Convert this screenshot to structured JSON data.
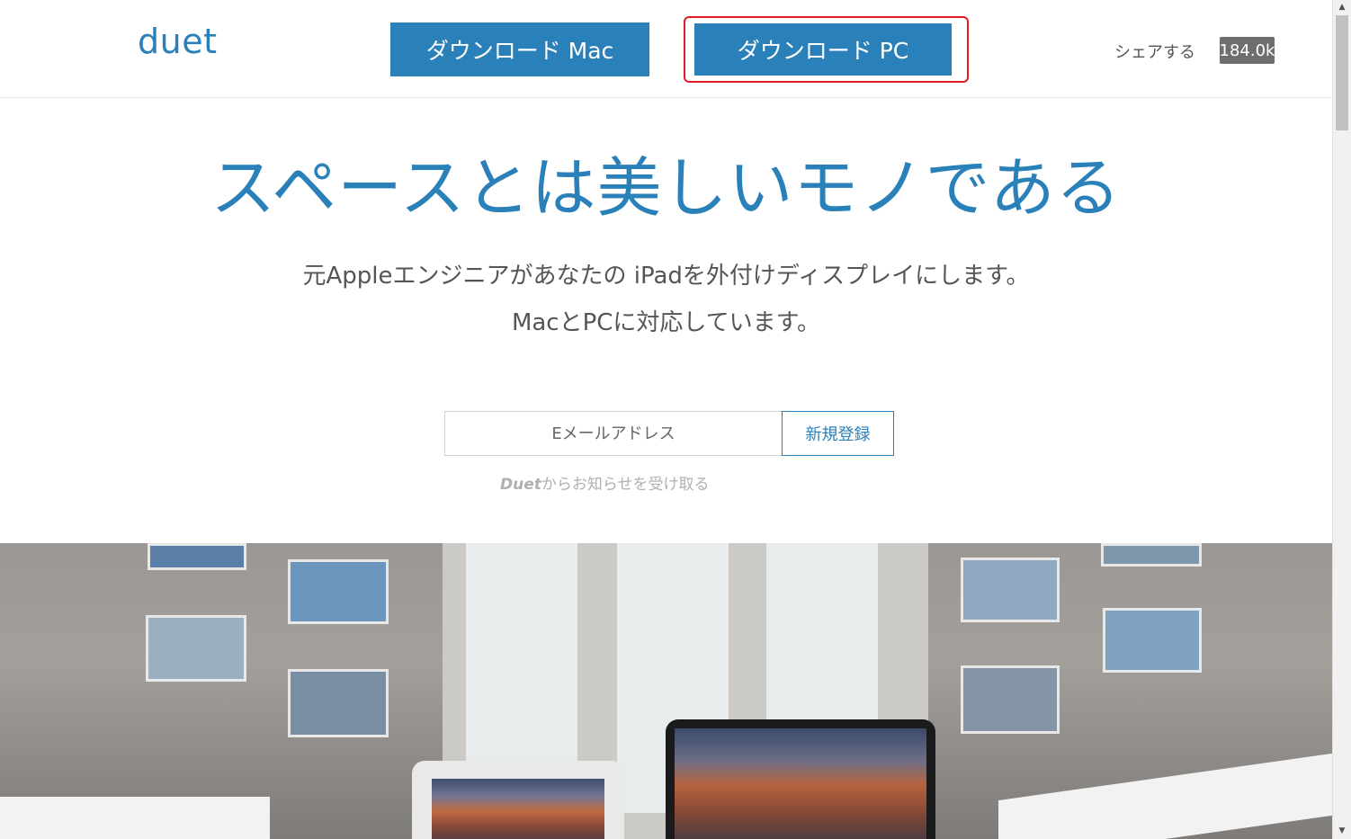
{
  "header": {
    "logo": "duet",
    "download_mac": "ダウンロード Mac",
    "download_pc": "ダウンロード PC",
    "share_label": "シェアする",
    "share_count": "184.0k"
  },
  "hero": {
    "title": "スペースとは美しいモノである",
    "subtitle_line1": "元Appleエンジニアがあなたの iPadを外付けディスプレイにします。",
    "subtitle_line2": "MacとPCに対応しています。"
  },
  "signup": {
    "email_placeholder": "Eメールアドレス",
    "button_label": "新規登録",
    "note_brand": "Duet",
    "note_text": "からお知らせを受け取る"
  },
  "colors": {
    "accent": "#2a80b9",
    "highlight_border": "#e21a22",
    "share_badge": "#6e6e6e"
  },
  "icons": {
    "scroll_up": "triangle-up-icon",
    "scroll_down": "triangle-down-icon"
  }
}
